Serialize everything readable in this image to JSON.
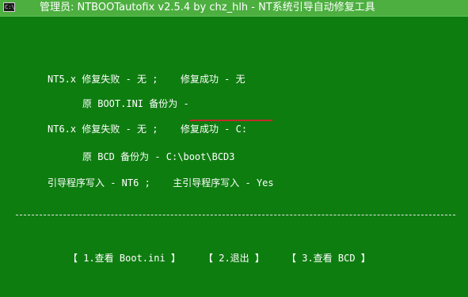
{
  "window": {
    "icon_text": "C:\\",
    "title": "管理员:  NTBOOTautofix v2.5.4 by chz_hlh - NT系统引导自动修复工具"
  },
  "console": {
    "nt5": {
      "prefix": "NT5.x",
      "fail": "修复失败 - 无 ;",
      "success": "修复成功 - 无"
    },
    "nt5_backup": "原 BOOT.INI 备份为 -",
    "nt6": {
      "prefix": "NT6.x",
      "fail": "修复失败 - 无 ;",
      "success": "修复成功 - C:"
    },
    "nt6_backup": "原 BCD 备份为 - C:\\boot\\BCD3",
    "boot_writer": {
      "label": "引导程序写入 - NT6   ;",
      "mbr": "主引导程序写入 - Yes"
    },
    "divider": "------------------------------------------------------------------------------------------------------------------"
  },
  "menu": {
    "view_boot_ini": "【 1.查看 Boot.ini 】",
    "exit": "【 2.退出 】",
    "view_bcd": "【   3.查看   BCD    】"
  },
  "colors": {
    "console_bg": "#0e7d10",
    "titlebar_bg": "#4caf3f",
    "highlight_underline": "#c62a2a"
  }
}
